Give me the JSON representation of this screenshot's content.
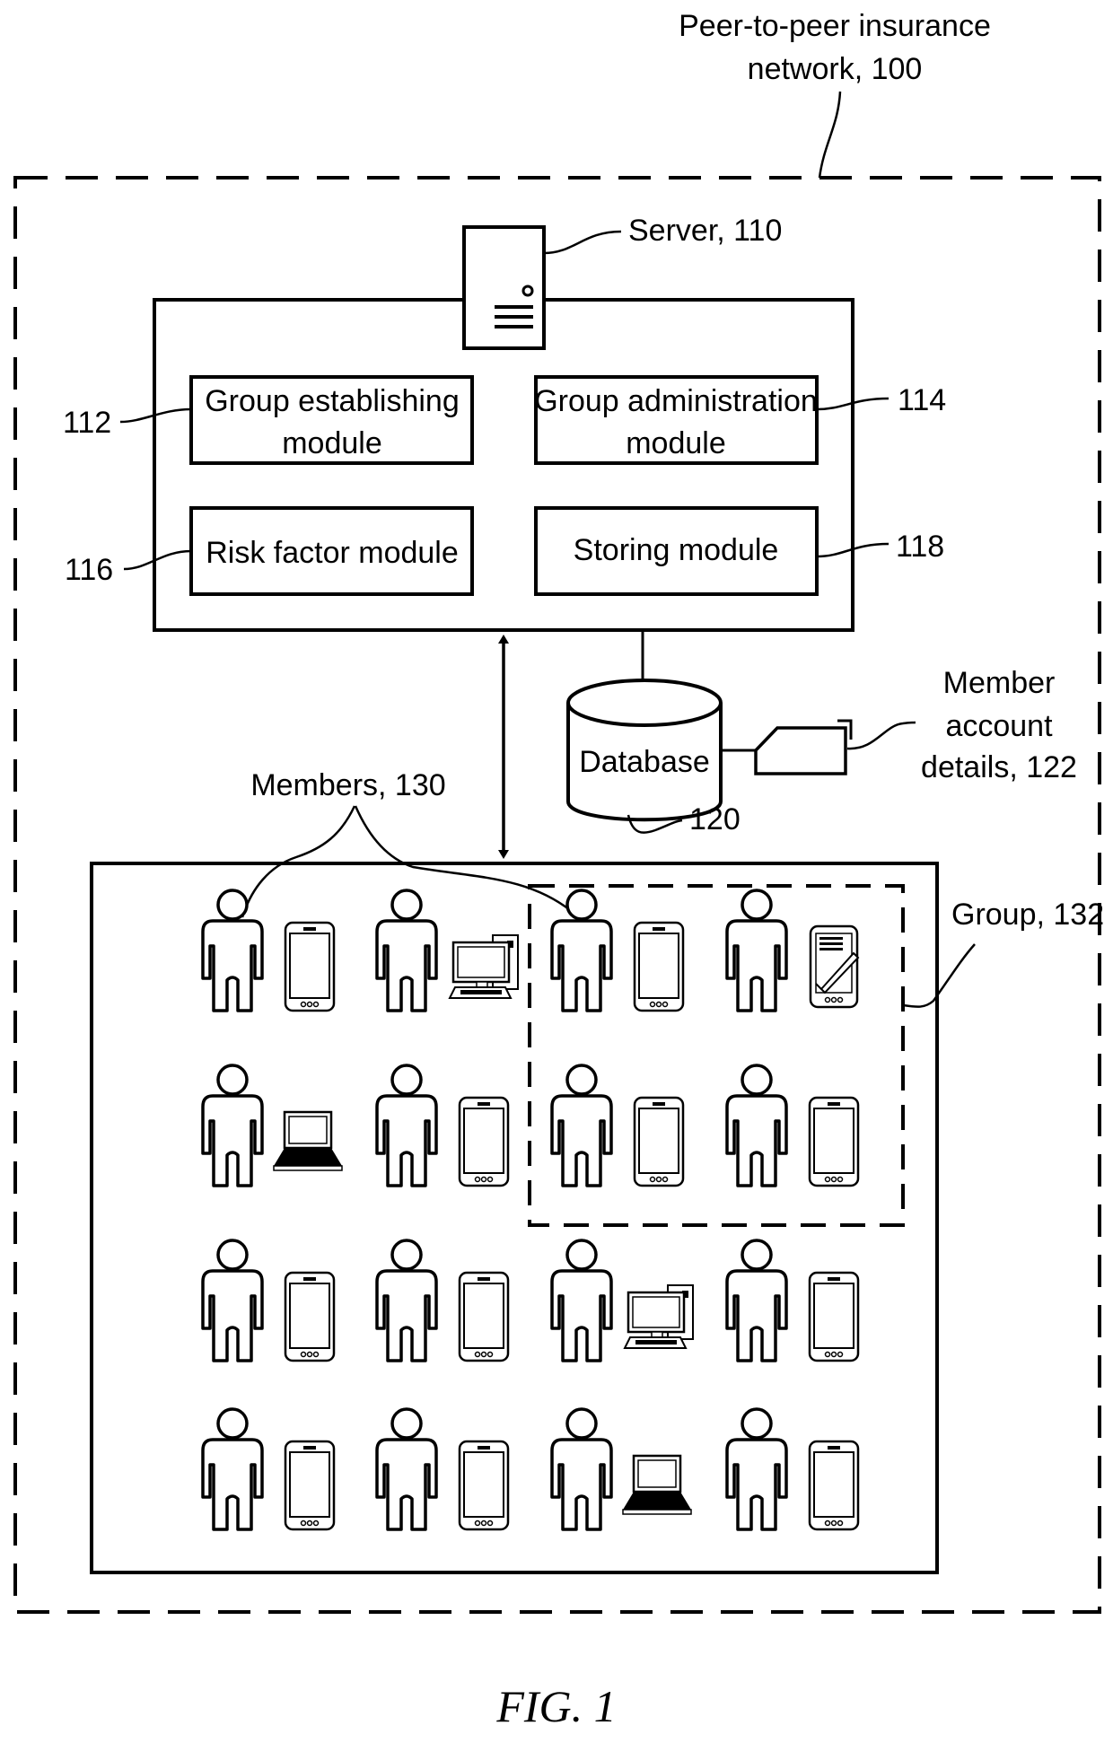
{
  "network": {
    "label_line1": "Peer-to-peer insurance",
    "label_line2": "network, 100"
  },
  "server": {
    "label": "Server, 110"
  },
  "modules": [
    {
      "id": "112",
      "ref": "112",
      "line1": "Group establishing",
      "line2": "module"
    },
    {
      "id": "114",
      "ref": "114",
      "line1": "Group administration",
      "line2": "module"
    },
    {
      "id": "116",
      "ref": "116",
      "line1": "Risk factor module",
      "line2": ""
    },
    {
      "id": "118",
      "ref": "118",
      "line1": "Storing module",
      "line2": ""
    }
  ],
  "database": {
    "label": "Database",
    "ref": "120"
  },
  "account": {
    "line1": "Member",
    "line2": "account",
    "line3": "details, 122"
  },
  "members": {
    "label": "Members, 130"
  },
  "group": {
    "label": "Group, 132"
  },
  "devices": [
    [
      "phone",
      "desktop",
      "phone",
      "tablet"
    ],
    [
      "laptop",
      "phone",
      "phone",
      "phone"
    ],
    [
      "phone",
      "phone",
      "desktop",
      "phone"
    ],
    [
      "phone",
      "phone",
      "laptop",
      "phone"
    ]
  ],
  "figure": {
    "caption": "FIG. 1"
  }
}
